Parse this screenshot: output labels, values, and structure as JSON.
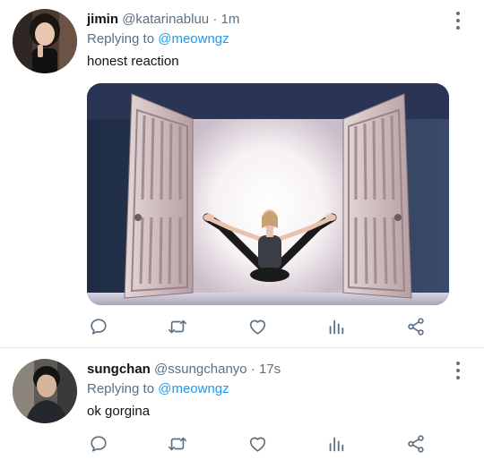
{
  "tweets": [
    {
      "display_name": "jimin",
      "handle": "@katarinabluu",
      "separator": "·",
      "time": "1m",
      "replying_prefix": "Replying to",
      "replying_to": "@meowngz",
      "text": "honest reaction",
      "has_media": true
    },
    {
      "display_name": "sungchan",
      "handle": "@ssungchanyo",
      "separator": "·",
      "time": "17s",
      "replying_prefix": "Replying to",
      "replying_to": "@meowngz",
      "text": "ok gorgina",
      "has_media": false
    }
  ],
  "icons": {
    "actions": [
      "reply-icon",
      "retweet-icon",
      "like-icon",
      "analytics-icon",
      "share-icon"
    ],
    "menu": "more-options-icon"
  },
  "colors": {
    "text": "#0f1419",
    "secondary": "#5b7083",
    "link": "#1d9bf0",
    "divider": "#e6e9ec"
  }
}
